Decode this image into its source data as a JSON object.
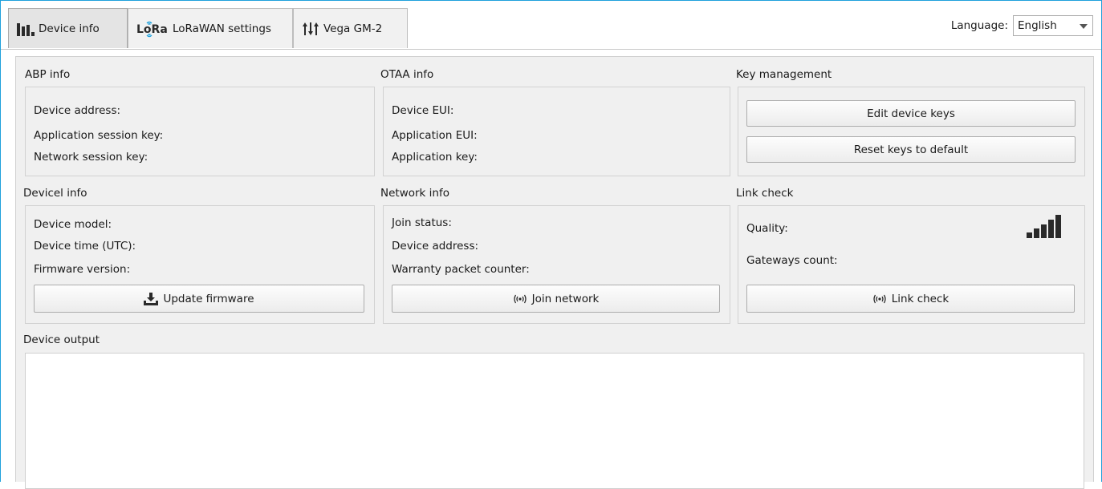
{
  "tabs": [
    {
      "label": "Device info",
      "icon": "bar-chart-icon",
      "active": true
    },
    {
      "label": "LoRaWAN settings",
      "icon": "lora-logo-icon",
      "logo_text": "LoRa",
      "active": false
    },
    {
      "label": "Vega GM-2",
      "icon": "sort-arrows-icon",
      "active": false
    }
  ],
  "language": {
    "label": "Language:",
    "selected": "English"
  },
  "abp": {
    "title": "ABP info",
    "device_address": "Device address:",
    "app_session_key": "Application session key:",
    "network_session_key": "Network session key:"
  },
  "otaa": {
    "title": "OTAA info",
    "device_eui": "Device EUI:",
    "application_eui": "Application EUI:",
    "application_key": "Application key:"
  },
  "keys": {
    "title": "Key management",
    "edit_label": "Edit device keys",
    "reset_label": "Reset keys to default"
  },
  "device": {
    "title": "Devicel info",
    "model": "Device model:",
    "time": "Device time (UTC):",
    "firmware": "Firmware version:",
    "update_label": "Update firmware"
  },
  "network": {
    "title": "Network info",
    "join_status": "Join status:",
    "device_address": "Device address:",
    "warranty_counter": "Warranty packet counter:",
    "join_label": "Join network"
  },
  "link": {
    "title": "Link check",
    "quality": "Quality:",
    "gateways": "Gateways count:",
    "check_label": "Link check"
  },
  "output": {
    "title": "Device output"
  },
  "colors": {
    "accent_border": "#1ea0dc",
    "panel_bg": "#f0f0f0"
  }
}
